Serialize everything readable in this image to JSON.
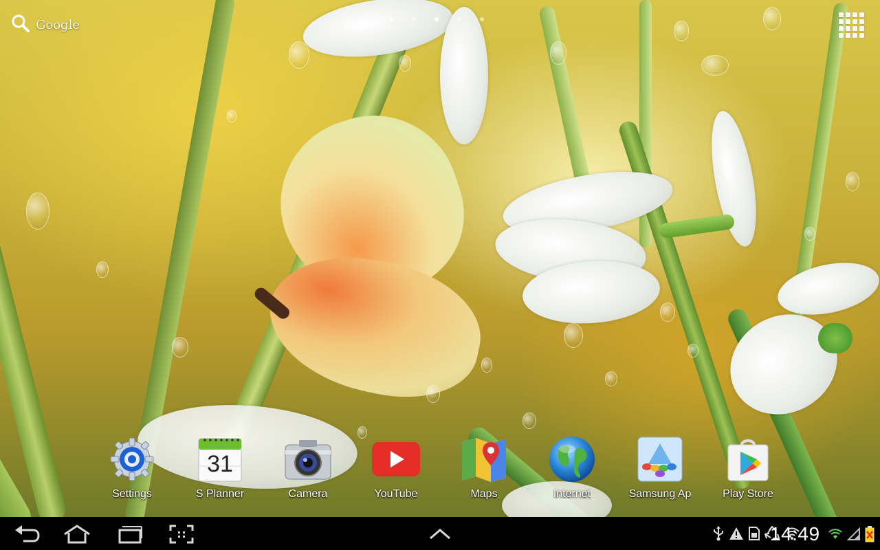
{
  "search": {
    "label": "Google",
    "icon": "search-icon"
  },
  "home_pages": {
    "count": 5,
    "active_index": 2
  },
  "apps_button": {
    "icon": "apps-grid-icon"
  },
  "dock": {
    "apps": [
      {
        "label": "Settings",
        "icon": "settings-gear-icon"
      },
      {
        "label": "S Planner",
        "icon": "calendar-icon",
        "day": "31"
      },
      {
        "label": "Camera",
        "icon": "camera-icon"
      },
      {
        "label": "YouTube",
        "icon": "youtube-icon"
      },
      {
        "label": "Maps",
        "icon": "maps-icon"
      },
      {
        "label": "Internet",
        "icon": "globe-icon"
      },
      {
        "label": "Samsung Ap",
        "icon": "samsung-apps-icon"
      },
      {
        "label": "Play Store",
        "icon": "play-store-icon"
      }
    ]
  },
  "nav_bar": {
    "buttons": [
      "back-icon",
      "home-icon",
      "recent-apps-icon",
      "screenshot-icon",
      "up-arrow-icon"
    ],
    "clock": "14:49",
    "status_icons": [
      "usb-icon",
      "warning-icon",
      "sd-card-icon",
      "recycle-icon",
      "wifi-unknown-icon"
    ],
    "right_icons": [
      "wifi-signal-icon",
      "signal-icon",
      "battery-empty-icon"
    ]
  },
  "colors": {
    "nav_background": "#000000",
    "youtube_red": "#e52d27",
    "calendar_green": "#6cbf2a",
    "text": "#ffffff"
  }
}
